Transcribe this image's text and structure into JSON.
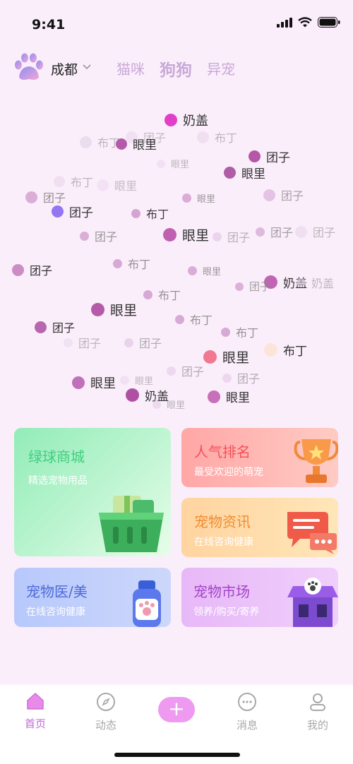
{
  "status": {
    "time": "9:41"
  },
  "header": {
    "city": "成都",
    "tabs": [
      "猫咪",
      "狗狗",
      "异宠"
    ],
    "active_tab": "狗狗"
  },
  "cloud": {
    "tags": [
      {
        "label": "奶盖",
        "color": "#e040c8",
        "dot": 18,
        "size": 18,
        "op": 1
      },
      {
        "label": "布丁",
        "color": "#e0cde6",
        "dot": 17,
        "size": 16,
        "op": 0.55
      },
      {
        "label": "团子",
        "color": "#e6d3ea",
        "dot": 17,
        "size": 16,
        "op": 0.5
      },
      {
        "label": "眼里",
        "color": "#b45aa8",
        "dot": 16,
        "size": 17,
        "op": 1
      },
      {
        "label": "布丁",
        "color": "#e6d3ea",
        "dot": 17,
        "size": 16,
        "op": 0.55
      },
      {
        "label": "团子",
        "color": "#b457a8",
        "dot": 17,
        "size": 17,
        "op": 1
      },
      {
        "label": "眼里",
        "color": "#ead8ee",
        "dot": 12,
        "size": 13,
        "op": 0.55
      },
      {
        "label": "眼里",
        "color": "#b05ca6",
        "dot": 17,
        "size": 17,
        "op": 1
      },
      {
        "label": "布丁",
        "color": "#e6d3ea",
        "dot": 16,
        "size": 16,
        "op": 0.55
      },
      {
        "label": "眼里",
        "color": "#ead8ee",
        "dot": 17,
        "size": 16,
        "op": 0.5
      },
      {
        "label": "团子",
        "color": "#d8a8d4",
        "dot": 17,
        "size": 16,
        "op": 0.9
      },
      {
        "label": "眼里",
        "color": "#d4a2d0",
        "dot": 13,
        "size": 13,
        "op": 0.85
      },
      {
        "label": "团子",
        "color": "#dcb4dc",
        "dot": 17,
        "size": 16,
        "op": 0.75
      },
      {
        "label": "团子",
        "color": "#9276f2",
        "dot": 17,
        "size": 17,
        "op": 1
      },
      {
        "label": "布丁",
        "color": "#d4a2d0",
        "dot": 13,
        "size": 16,
        "op": 0.95
      },
      {
        "label": "团子",
        "color": "#d4a2d0",
        "dot": 13,
        "size": 16,
        "op": 0.85
      },
      {
        "label": "眼里",
        "color": "#c060b0",
        "dot": 19,
        "size": 19,
        "op": 1
      },
      {
        "label": "团子",
        "color": "#e0c6e4",
        "dot": 13,
        "size": 16,
        "op": 0.6
      },
      {
        "label": "团子",
        "color": "#d7add6",
        "dot": 13,
        "size": 16,
        "op": 0.8
      },
      {
        "label": "团子",
        "color": "#e6d3ea",
        "dot": 17,
        "size": 16,
        "op": 0.55
      },
      {
        "label": "团子",
        "color": "#cc8cc4",
        "dot": 17,
        "size": 16,
        "op": 1
      },
      {
        "label": "布丁",
        "color": "#d4a2d0",
        "dot": 13,
        "size": 16,
        "op": 0.9
      },
      {
        "label": "眼里",
        "color": "#d4a2d0",
        "dot": 13,
        "size": 13,
        "op": 0.85
      },
      {
        "label": "奶盖",
        "color": "#c064b4",
        "dot": 19,
        "size": 17,
        "op": 1
      },
      {
        "label": "奶盖",
        "color": "#ead8ee",
        "dot": 13,
        "size": 16,
        "op": 0.55
      },
      {
        "label": "团子",
        "color": "#d4a2d0",
        "dot": 12,
        "size": 15,
        "op": 0.8
      },
      {
        "label": "布丁",
        "color": "#d4a2d0",
        "dot": 13,
        "size": 16,
        "op": 0.9
      },
      {
        "label": "眼里",
        "color": "#b45aa8",
        "dot": 19,
        "size": 19,
        "op": 1
      },
      {
        "label": "团子",
        "color": "#b866ae",
        "dot": 17,
        "size": 16,
        "op": 1
      },
      {
        "label": "布丁",
        "color": "#d4a2d0",
        "dot": 13,
        "size": 16,
        "op": 0.9
      },
      {
        "label": "布丁",
        "color": "#d4a2d0",
        "dot": 13,
        "size": 16,
        "op": 0.9
      },
      {
        "label": "团子",
        "color": "#ead8ee",
        "dot": 13,
        "size": 16,
        "op": 0.55
      },
      {
        "label": "团子",
        "color": "#e0c6e4",
        "dot": 13,
        "size": 16,
        "op": 0.65
      },
      {
        "label": "眼里",
        "color": "#f07890",
        "dot": 19,
        "size": 19,
        "op": 1
      },
      {
        "label": "布丁",
        "color": "#fde4d8",
        "dot": 19,
        "size": 17,
        "op": 1
      },
      {
        "label": "团子",
        "color": "#e6cce8",
        "dot": 13,
        "size": 16,
        "op": 0.65
      },
      {
        "label": "团子",
        "color": "#e6cce8",
        "dot": 13,
        "size": 16,
        "op": 0.65
      },
      {
        "label": "眼里",
        "color": "#c070b8",
        "dot": 18,
        "size": 18,
        "op": 1
      },
      {
        "label": "眼里",
        "color": "#ead8ee",
        "dot": 13,
        "size": 13,
        "op": 0.55
      },
      {
        "label": "奶盖",
        "color": "#b050a4",
        "dot": 19,
        "size": 17,
        "op": 1
      },
      {
        "label": "眼里",
        "color": "#e6cce8",
        "dot": 12,
        "size": 13,
        "op": 0.6
      },
      {
        "label": "眼里",
        "color": "#c870b8",
        "dot": 18,
        "size": 17,
        "op": 1
      }
    ]
  },
  "cards": [
    {
      "title": "绿球商城",
      "subtitle": "精选宠物用品",
      "title_color": "#3fcf7e"
    },
    {
      "title": "人气排名",
      "subtitle": "最受欢迎的萌宠",
      "title_color": "#f4505a"
    },
    {
      "title": "宠物资讯",
      "subtitle": "在线咨询健康",
      "title_color": "#ee8c32"
    },
    {
      "title": "宠物医/美",
      "subtitle": "在线咨询健康",
      "title_color": "#4d6ad8"
    },
    {
      "title": "宠物市场",
      "subtitle": "领养/购买/寄养",
      "title_color": "#a244c8"
    }
  ],
  "nav": {
    "items": [
      "首页",
      "动态",
      "+",
      "消息",
      "我的"
    ],
    "active": "首页"
  }
}
